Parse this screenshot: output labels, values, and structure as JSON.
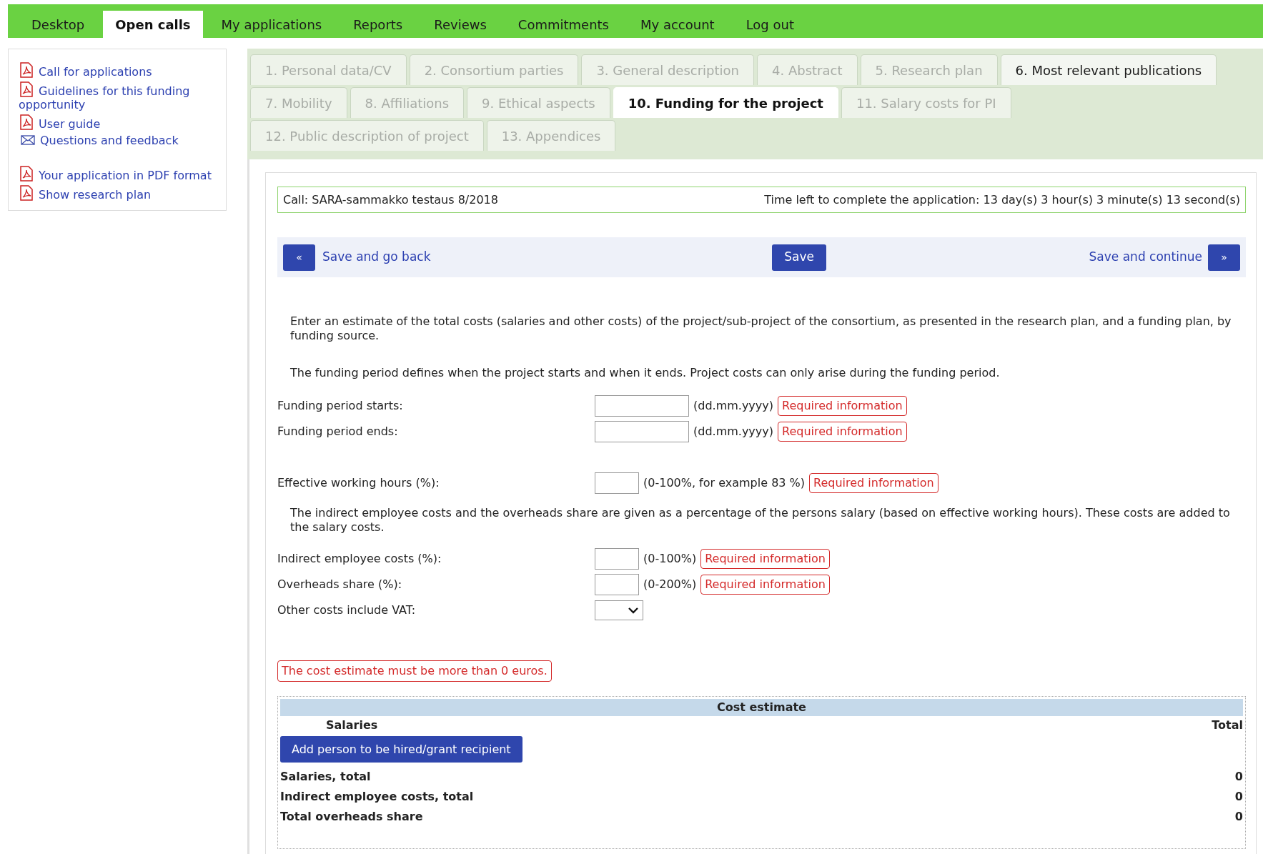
{
  "top_nav": [
    {
      "label": "Desktop",
      "selected": false
    },
    {
      "label": "Open calls",
      "selected": true
    },
    {
      "label": "My applications",
      "selected": false
    },
    {
      "label": "Reports",
      "selected": false
    },
    {
      "label": "Reviews",
      "selected": false
    },
    {
      "label": "Commitments",
      "selected": false
    },
    {
      "label": "My account",
      "selected": false
    },
    {
      "label": "Log out",
      "selected": false
    }
  ],
  "sidebar": {
    "groups": [
      [
        {
          "label": "Call for applications",
          "kind": "pdf"
        },
        {
          "label": "Guidelines for this funding opportunity",
          "kind": "pdf"
        },
        {
          "label": "User guide",
          "kind": "pdf"
        },
        {
          "label": "Questions and feedback",
          "kind": "mail"
        }
      ],
      [
        {
          "label": "Your application in PDF format",
          "kind": "pdf"
        },
        {
          "label": "Show research plan",
          "kind": "pdf"
        }
      ]
    ]
  },
  "tab_rows": [
    [
      {
        "label": "1. Personal data/CV",
        "selected": false,
        "disabled": true
      },
      {
        "label": "2. Consortium parties",
        "selected": false,
        "disabled": true
      },
      {
        "label": "3. General description",
        "selected": false,
        "disabled": true
      },
      {
        "label": "4. Abstract",
        "selected": false,
        "disabled": true
      },
      {
        "label": "5. Research plan",
        "selected": false,
        "disabled": true
      },
      {
        "label": "6. Most relevant publications",
        "selected": false,
        "disabled": false
      }
    ],
    [
      {
        "label": "7. Mobility",
        "selected": false,
        "disabled": true
      },
      {
        "label": "8. Affiliations",
        "selected": false,
        "disabled": true
      },
      {
        "label": "9. Ethical aspects",
        "selected": false,
        "disabled": true
      },
      {
        "label": "10. Funding for the project",
        "selected": true,
        "disabled": false
      },
      {
        "label": "11. Salary costs for PI",
        "selected": false,
        "disabled": true
      }
    ],
    [
      {
        "label": "12. Public description of project",
        "selected": false,
        "disabled": true
      },
      {
        "label": "13. Appendices",
        "selected": false,
        "disabled": true
      }
    ]
  ],
  "call_bar": {
    "call": "Call: SARA-sammakko testaus 8/2018",
    "time_left": "Time left to complete the application: 13 day(s) 3 hour(s) 3 minute(s) 13 second(s)"
  },
  "action_bar": {
    "back_icon": "«",
    "back": "Save and go back",
    "save": "Save",
    "continue": "Save and continue",
    "continue_icon": "»"
  },
  "intro": [
    "Enter an estimate of the total costs (salaries and other costs) of the project/sub-project of the consortium, as presented in the research plan, and a funding plan, by funding source.",
    "The funding period defines when the project starts and when it ends. Project costs can only arise during the funding period."
  ],
  "form_sections": [
    [
      {
        "kind": "date",
        "label": "Funding period starts:",
        "hint": "(dd.mm.yyyy)",
        "error": "Required information"
      },
      {
        "kind": "date",
        "label": "Funding period ends:",
        "hint": "(dd.mm.yyyy)",
        "error": "Required information"
      }
    ],
    [
      {
        "kind": "percent",
        "label": "Effective working hours (%):",
        "hint": "(0-100%, for example 83 %)",
        "error": "Required information"
      },
      {
        "kind": "note",
        "text": "The indirect employee costs and the overheads share are given as a percentage of the persons salary (based on effective working hours). These costs are added to the salary costs."
      },
      {
        "kind": "percent",
        "label": "Indirect employee costs (%):",
        "hint": "(0-100%)",
        "error": "Required information"
      },
      {
        "kind": "percent",
        "label": "Overheads share (%):",
        "hint": "(0-200%)",
        "error": "Required information"
      },
      {
        "kind": "select",
        "label": "Other costs include VAT:"
      }
    ]
  ],
  "cost_error": "The cost estimate must be more than 0 euros.",
  "cost_estimate": {
    "title": "Cost estimate",
    "salaries_heading": "Salaries",
    "total_heading": "Total",
    "add_button": "Add person to be hired/grant recipient",
    "totals": [
      {
        "label": "Salaries, total",
        "value": "0"
      },
      {
        "label": "Indirect employee costs, total",
        "value": "0"
      },
      {
        "label": "Total overheads share",
        "value": "0"
      }
    ]
  }
}
